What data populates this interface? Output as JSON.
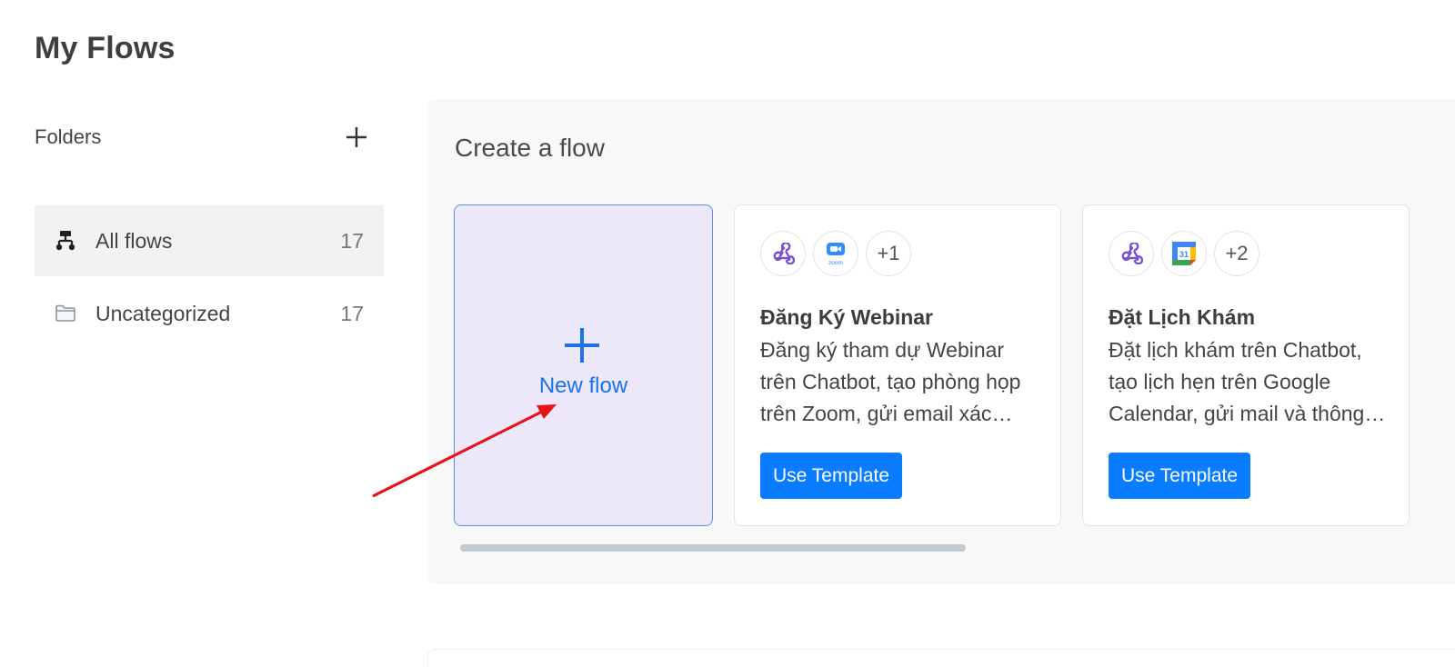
{
  "page": {
    "title": "My Flows"
  },
  "folders": {
    "label": "Folders",
    "items": [
      {
        "name": "All flows",
        "count": "17",
        "icon": "flow-tree-icon",
        "active": true
      },
      {
        "name": "Uncategorized",
        "count": "17",
        "icon": "folder-icon",
        "active": false
      }
    ]
  },
  "create": {
    "title": "Create a flow",
    "new_flow_label": "New flow",
    "templates": [
      {
        "apps": [
          "webhook-icon",
          "zoom-icon"
        ],
        "app_icon_text": {
          "zoom": "zoom"
        },
        "more": "+1",
        "title": "Đăng Ký Webinar",
        "description": "Đăng ký tham dự Webinar trên Chatbot, tạo phòng họp trên Zoom, gửi email xác nhận",
        "button": "Use Template"
      },
      {
        "apps": [
          "webhook-icon",
          "google-calendar-icon"
        ],
        "app_icon_text": {
          "calendar": "31"
        },
        "more": "+2",
        "title": "Đặt Lịch Khám",
        "description": "Đặt lịch khám trên Chatbot, tạo lịch hẹn trên Google Calendar, gửi mail và thông báo",
        "button": "Use Template"
      }
    ]
  },
  "colors": {
    "accent": "#0a7cff",
    "new_flow_bg": "#ede7fa",
    "annotation": "#e8131a"
  }
}
